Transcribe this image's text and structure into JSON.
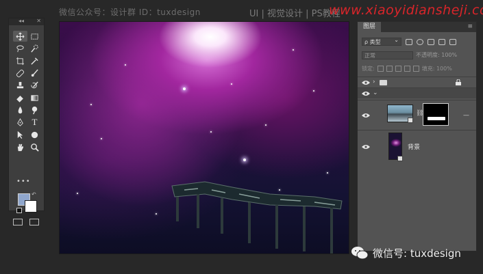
{
  "watermarks": {
    "top_left": "微信公众号：设计群  ID：tuxdesign",
    "top_mid": "UI | 视觉设计 | PS教程",
    "top_right_url": "www.xiaoyidiansheji.com",
    "bottom_right": "微信号: tuxdesign"
  },
  "toolbar": {
    "collapse_label": "◂◂",
    "close_label": "✕",
    "more_label": "•••",
    "tools": [
      "move-tool",
      "marquee-tool",
      "lasso-tool",
      "quick-select-tool",
      "crop-tool",
      "eyedropper-tool",
      "healing-brush-tool",
      "brush-tool",
      "clone-stamp-tool",
      "history-brush-tool",
      "eraser-tool",
      "gradient-tool",
      "blur-tool",
      "dodge-tool",
      "pen-tool",
      "type-tool",
      "path-select-tool",
      "ellipse-tool",
      "hand-tool",
      "zoom-tool"
    ],
    "type_tool_glyph": "T",
    "foreground_color": "#8fa6cc",
    "background_color": "#ffffff"
  },
  "layers_panel": {
    "tab_label": "图层",
    "menu_icon": "≡",
    "kind_filter": "ρ 类型",
    "blend_mode": "正常",
    "opacity_label": "不透明度: 100%",
    "lock_label": "锁定:",
    "fill_label": "填充: 100%",
    "layers": [
      {
        "type": "group",
        "visible": true,
        "locked": true,
        "expanded": false
      },
      {
        "type": "group-child-header",
        "visible": true,
        "expanded": true
      },
      {
        "type": "smart-object",
        "visible": true,
        "has_mask": true,
        "trailing": "—"
      },
      {
        "type": "smart-object",
        "visible": true,
        "name": "背景"
      }
    ]
  }
}
